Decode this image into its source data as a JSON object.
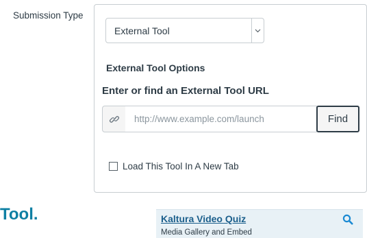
{
  "submission": {
    "label": "Submission Type",
    "select_value": "External Tool"
  },
  "external_tool": {
    "options_heading": "External Tool Options",
    "url_heading": "Enter or find an External Tool URL",
    "url_value": "",
    "url_placeholder": "http://www.example.com/launch",
    "find_label": "Find",
    "new_tab_checked": false,
    "new_tab_label": "Load This Tool In A New Tab"
  },
  "background_text": {
    "tool_fragment": "Tool."
  },
  "kaltura": {
    "title": "Kaltura Video Quiz",
    "description": "Media Gallery and Embed"
  },
  "icons": {
    "select_arrow": "chevron-down-icon",
    "url_addon": "link-icon",
    "kaltura_search": "search-icon"
  },
  "colors": {
    "text": "#2d3b45",
    "border": "#c7cdd1",
    "placeholder": "#8b969e",
    "link": "#1b5f8c",
    "tool_fragment": "#0e7fa3",
    "card_bg": "#e8f1f6",
    "search_icon": "#1b8ad3"
  }
}
